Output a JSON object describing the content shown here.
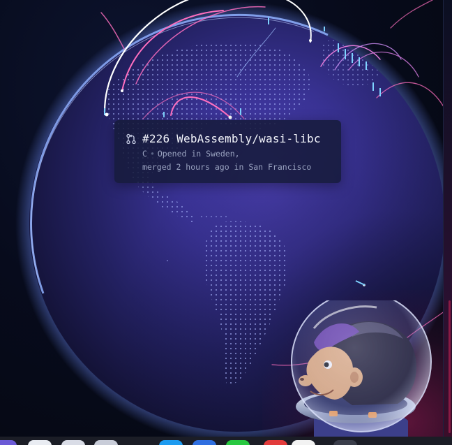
{
  "tooltip": {
    "title": "#226 WebAssembly/wasi-libc",
    "language": "C",
    "opened": "Opened in Sweden,",
    "merged": "merged 2 hours ago in San Francisco",
    "icon": "git-pull-request-icon"
  },
  "colors": {
    "background": "#05070f",
    "globe_core": "#2b2a7a",
    "globe_rim": "#7fa2ff",
    "arc_pink": "#ff5fb3",
    "arc_white": "#ffffff",
    "tooltip_bg": "#161b3a",
    "tooltip_text": "#e6e9f5",
    "tooltip_muted": "#9aa3c0"
  },
  "mascot": {
    "icon": "mona-astronaut-icon"
  },
  "dock": {
    "apps": [
      "app-icon",
      "app-icon",
      "app-icon",
      "app-icon",
      "app-icon",
      "app-icon",
      "app-icon",
      "app-icon",
      "app-icon",
      "app-icon"
    ]
  }
}
